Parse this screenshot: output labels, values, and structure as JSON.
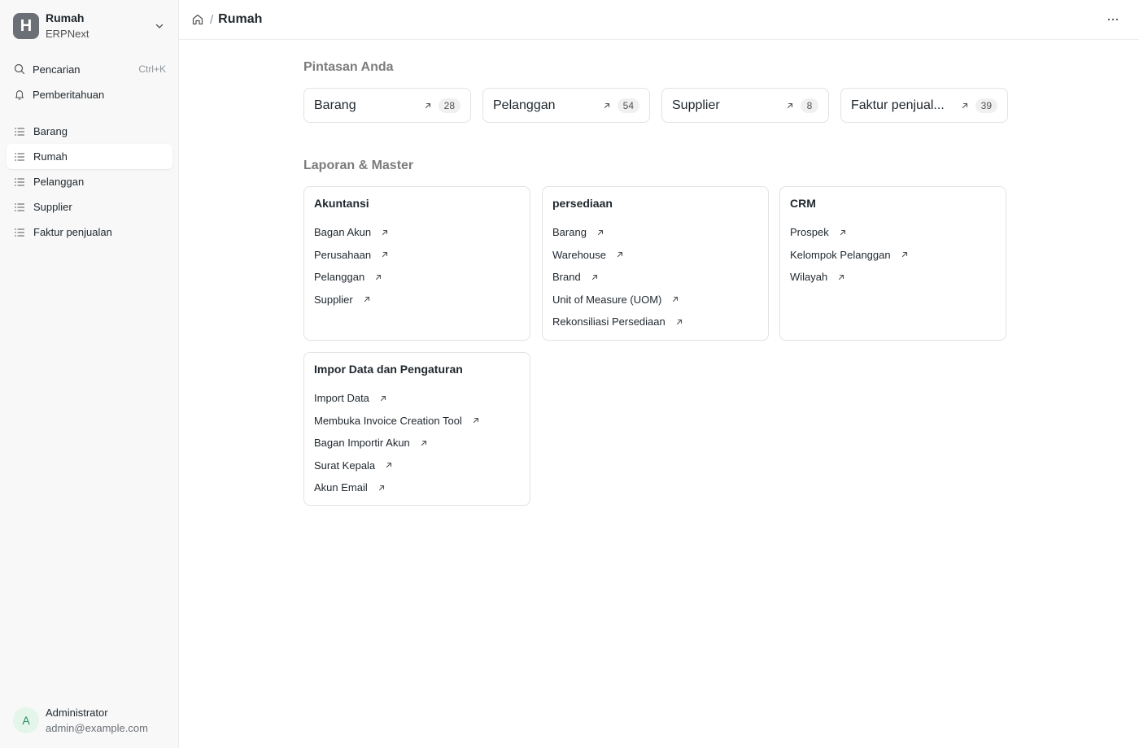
{
  "sidebar": {
    "workspace": {
      "logo_letter": "H",
      "title": "Rumah",
      "subtitle": "ERPNext"
    },
    "search": {
      "label": "Pencarian",
      "shortcut": "Ctrl+K"
    },
    "notifications": {
      "label": "Pemberitahuan"
    },
    "items": [
      {
        "label": "Barang",
        "active": false
      },
      {
        "label": "Rumah",
        "active": true
      },
      {
        "label": "Pelanggan",
        "active": false
      },
      {
        "label": "Supplier",
        "active": false
      },
      {
        "label": "Faktur penjualan",
        "active": false
      }
    ],
    "user": {
      "initial": "A",
      "name": "Administrator",
      "email": "admin@example.com"
    }
  },
  "header": {
    "breadcrumb_separator": "/",
    "title": "Rumah"
  },
  "shortcuts": {
    "title": "Pintasan Anda",
    "items": [
      {
        "label": "Barang",
        "count": "28"
      },
      {
        "label": "Pelanggan",
        "count": "54"
      },
      {
        "label": "Supplier",
        "count": "8"
      },
      {
        "label": "Faktur penjual...",
        "count": "39"
      }
    ]
  },
  "reports": {
    "title": "Laporan & Master",
    "cards": [
      {
        "title": "Akuntansi",
        "links": [
          "Bagan Akun",
          "Perusahaan",
          "Pelanggan",
          "Supplier"
        ]
      },
      {
        "title": "persediaan",
        "links": [
          "Barang",
          "Warehouse",
          "Brand",
          "Unit of Measure (UOM)",
          "Rekonsiliasi Persediaan"
        ]
      },
      {
        "title": "CRM",
        "links": [
          "Prospek",
          "Kelompok Pelanggan",
          "Wilayah"
        ]
      },
      {
        "title": "Impor Data dan Pengaturan",
        "links": [
          "Import Data",
          "Membuka Invoice Creation Tool",
          "Bagan Importir Akun",
          "Surat Kepala",
          "Akun Email"
        ]
      }
    ]
  },
  "colors": {
    "accent_avatar_bg": "#e4f5e9",
    "accent_avatar_fg": "#278f5e",
    "logo_bg": "#6b7076"
  }
}
